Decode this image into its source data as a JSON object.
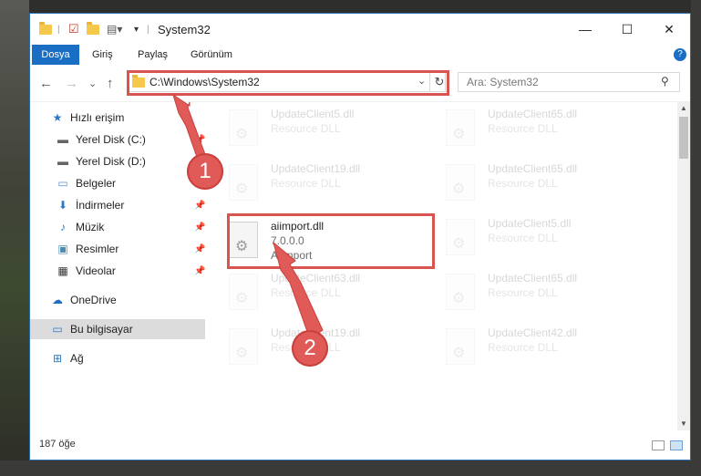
{
  "window": {
    "title": "System32",
    "controls": {
      "minimize": "—",
      "maximize": "☐",
      "close": "✕"
    }
  },
  "ribbon": {
    "tabs": [
      "Dosya",
      "Giriş",
      "Paylaş",
      "Görünüm"
    ],
    "help": "?"
  },
  "nav": {
    "back": "←",
    "forward": "→",
    "recent": "⌄",
    "up": "↑",
    "address": "C:\\Windows\\System32",
    "refresh": "↻",
    "search_placeholder": "Ara: System32"
  },
  "sidebar": {
    "items": [
      {
        "label": "Hızlı erişim",
        "icon": "star-icon",
        "pinned": false
      },
      {
        "label": "Yerel Disk (C:)",
        "icon": "drive-icon",
        "pinned": true
      },
      {
        "label": "Yerel Disk (D:)",
        "icon": "drive-icon",
        "pinned": true
      },
      {
        "label": "Belgeler",
        "icon": "documents-icon",
        "pinned": true
      },
      {
        "label": "İndirmeler",
        "icon": "download-icon",
        "pinned": true
      },
      {
        "label": "Müzik",
        "icon": "music-icon",
        "pinned": true
      },
      {
        "label": "Resimler",
        "icon": "pictures-icon",
        "pinned": true
      },
      {
        "label": "Videolar",
        "icon": "video-icon",
        "pinned": true
      },
      {
        "label": "OneDrive",
        "icon": "cloud-icon",
        "pinned": false
      },
      {
        "label": "Bu bilgisayar",
        "icon": "computer-icon",
        "pinned": false,
        "selected": true
      },
      {
        "label": "Ağ",
        "icon": "network-icon",
        "pinned": false
      }
    ]
  },
  "files": {
    "left_column": [
      {
        "name": "UpdateClient5.dll",
        "sub": "Resource DLL",
        "faded": true
      },
      {
        "name": "UpdateClient19.dll",
        "sub": "Resource DLL",
        "faded": true
      },
      {
        "name": "aiimport.dll",
        "sub": "7.0.0.0",
        "type": "AIImport",
        "faded": false,
        "highlighted": true
      },
      {
        "name": "UpdateClient63.dll",
        "sub": "Resource DLL",
        "faded": true
      },
      {
        "name": "UpdateClient19.dll",
        "sub": "Resource DLL",
        "faded": true
      }
    ],
    "right_column": [
      {
        "name": "UpdateClient65.dll",
        "sub": "Resource DLL",
        "faded": true
      },
      {
        "name": "UpdateClient65.dll",
        "sub": "Resource DLL",
        "faded": true
      },
      {
        "name": "UpdateClient5.dll",
        "sub": "Resource DLL",
        "faded": true
      },
      {
        "name": "UpdateClient65.dll",
        "sub": "Resource DLL",
        "faded": true
      },
      {
        "name": "UpdateClient42.dll",
        "sub": "Resource DLL",
        "faded": true
      }
    ]
  },
  "status": {
    "count": "187 öğe"
  },
  "annotations": {
    "marker1": "1",
    "marker2": "2",
    "color": "#d9534f"
  }
}
